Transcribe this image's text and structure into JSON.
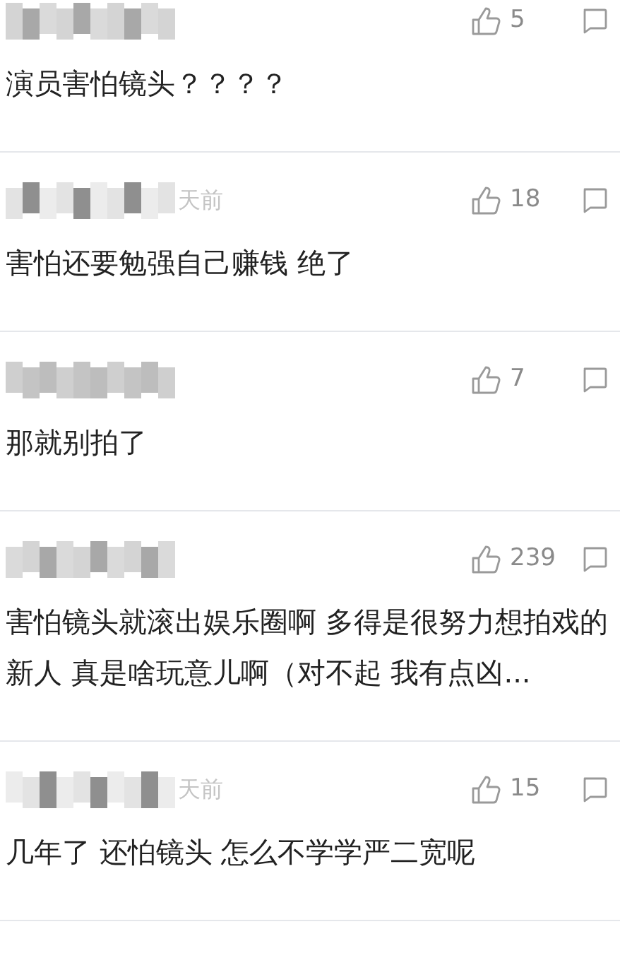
{
  "comments": [
    {
      "likes": "5",
      "text": "演员害怕镜头？？？？"
    },
    {
      "time": "天前",
      "likes": "18",
      "text": "害怕还要勉强自己赚钱 绝了"
    },
    {
      "likes": "7",
      "text": "那就别拍了"
    },
    {
      "likes": "239",
      "text": "害怕镜头就滚出娱乐圈啊 多得是很努力想拍戏的新人 真是啥玩意儿啊（对不起 我有点凶..."
    },
    {
      "time": "天前",
      "likes": "15",
      "text": "几年了 还怕镜头 怎么不学学严二宽呢"
    }
  ]
}
